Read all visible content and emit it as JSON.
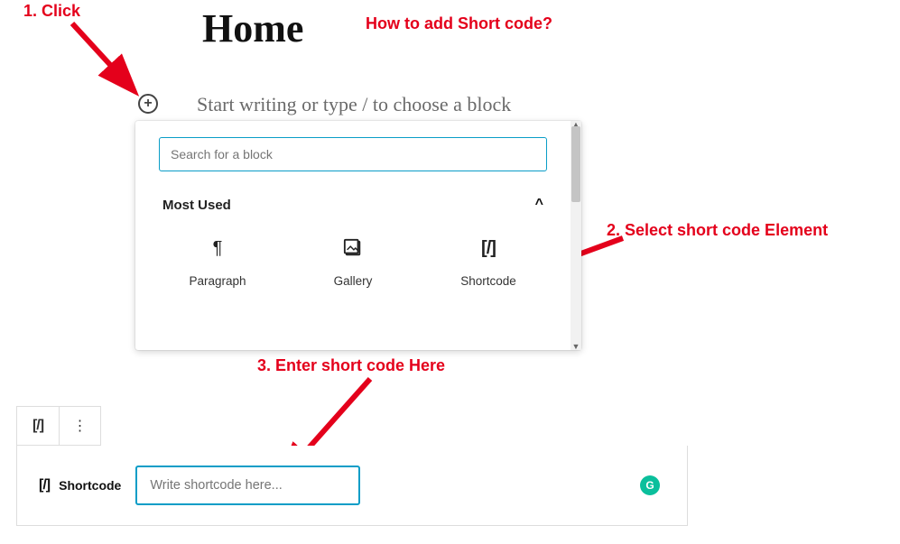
{
  "page": {
    "title": "Home"
  },
  "annotations": {
    "heading": "How to add Short code?",
    "step1": "1. Click",
    "step2": "2. Select short code Element",
    "step3": "3. Enter short code Here"
  },
  "editor": {
    "prompt": "Start writing or type / to choose a block",
    "add_icon": "plus-circle-icon"
  },
  "inserter": {
    "search_placeholder": "Search for a block",
    "section_title": "Most Used",
    "collapse_icon": "chevron-up-icon",
    "blocks": [
      {
        "id": "paragraph",
        "label": "Paragraph",
        "icon": "paragraph-icon"
      },
      {
        "id": "gallery",
        "label": "Gallery",
        "icon": "gallery-icon"
      },
      {
        "id": "shortcode",
        "label": "Shortcode",
        "icon": "shortcode-icon"
      }
    ]
  },
  "shortcode_block": {
    "label": "Shortcode",
    "placeholder": "Write shortcode here...",
    "toolbar": {
      "block_icon": "shortcode-icon",
      "more_icon": "more-vertical-icon"
    },
    "assist_icon": "grammarly-icon",
    "assist_glyph": "G"
  },
  "glyphs": {
    "paragraph": "¶",
    "shortcode": "[/]",
    "chevron_up": "^",
    "more": "⋮"
  }
}
